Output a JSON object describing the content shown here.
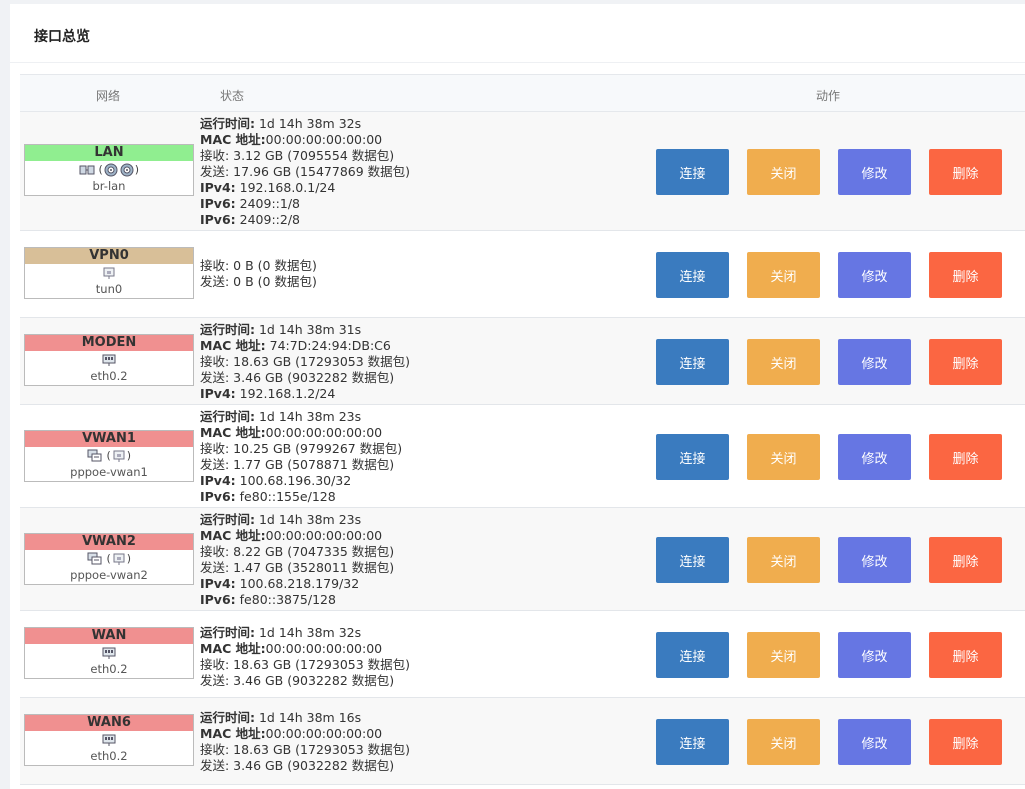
{
  "page": {
    "title": "接口总览"
  },
  "table": {
    "headers": {
      "network": "网络",
      "status": "状态",
      "actions": "动作"
    }
  },
  "buttons": {
    "connect": "连接",
    "close": "关闭",
    "edit": "修改",
    "delete": "删除"
  },
  "colors": {
    "connect": "#3a7bbf",
    "close": "#f0ad4e",
    "edit": "#6676e3",
    "delete": "#fb6642",
    "lan": "#90ee90",
    "vpn": "#d8bf98",
    "wan": "#f09090"
  },
  "rows": [
    {
      "name": "LAN",
      "device": "br-lan",
      "color": "green",
      "icons": [
        "bridge-icon",
        "wireless-icon",
        "wireless-icon"
      ],
      "status": [
        {
          "k": "运行时间:",
          "v": " 1d 14h 38m 32s"
        },
        {
          "k": "MAC 地址:",
          "v": "00:00:00:00:00:00"
        },
        {
          "k": "",
          "v": "接收: 3.12 GB (7095554 数据包)"
        },
        {
          "k": "",
          "v": "发送: 17.96 GB (15477869 数据包)"
        },
        {
          "k": "IPv4:",
          "v": " 192.168.0.1/24"
        },
        {
          "k": "IPv6:",
          "v": " 2409::1/8"
        },
        {
          "k": "IPv6:",
          "v": " 2409::2/8"
        }
      ]
    },
    {
      "name": "VPN0",
      "device": "tun0",
      "color": "tan",
      "icons": [
        "tunnel-icon"
      ],
      "status": [
        {
          "k": "",
          "v": "接收: 0 B (0 数据包)"
        },
        {
          "k": "",
          "v": "发送: 0 B (0 数据包)"
        }
      ]
    },
    {
      "name": "MODEN",
      "device": "eth0.2",
      "color": "red",
      "icons": [
        "ethernet-icon"
      ],
      "status": [
        {
          "k": "运行时间:",
          "v": " 1d 14h 38m 31s"
        },
        {
          "k": "MAC 地址:",
          "v": " 74:7D:24:94:DB:C6"
        },
        {
          "k": "",
          "v": "接收: 18.63 GB (17293053 数据包)"
        },
        {
          "k": "",
          "v": "发送: 3.46 GB (9032282 数据包)"
        },
        {
          "k": "IPv4:",
          "v": " 192.168.1.2/24"
        }
      ]
    },
    {
      "name": "VWAN1",
      "device": "pppoe-vwan1",
      "color": "red",
      "icons": [
        "pppoe-icon",
        "tunnel-icon"
      ],
      "status": [
        {
          "k": "运行时间:",
          "v": " 1d 14h 38m 23s"
        },
        {
          "k": "MAC 地址:",
          "v": "00:00:00:00:00:00"
        },
        {
          "k": "",
          "v": "接收: 10.25 GB (9799267 数据包)"
        },
        {
          "k": "",
          "v": "发送: 1.77 GB (5078871 数据包)"
        },
        {
          "k": "IPv4:",
          "v": " 100.68.196.30/32"
        },
        {
          "k": "IPv6:",
          "v": " fe80::155e/128"
        }
      ]
    },
    {
      "name": "VWAN2",
      "device": "pppoe-vwan2",
      "color": "red",
      "icons": [
        "pppoe-icon",
        "tunnel-icon"
      ],
      "status": [
        {
          "k": "运行时间:",
          "v": " 1d 14h 38m 23s"
        },
        {
          "k": "MAC 地址:",
          "v": "00:00:00:00:00:00"
        },
        {
          "k": "",
          "v": "接收: 8.22 GB (7047335 数据包)"
        },
        {
          "k": "",
          "v": "发送: 1.47 GB (3528011 数据包)"
        },
        {
          "k": "IPv4:",
          "v": " 100.68.218.179/32"
        },
        {
          "k": "IPv6:",
          "v": " fe80::3875/128"
        }
      ]
    },
    {
      "name": "WAN",
      "device": "eth0.2",
      "color": "red",
      "icons": [
        "ethernet-icon"
      ],
      "status": [
        {
          "k": "运行时间:",
          "v": " 1d 14h 38m 32s"
        },
        {
          "k": "MAC 地址:",
          "v": "00:00:00:00:00:00"
        },
        {
          "k": "",
          "v": "接收: 18.63 GB (17293053 数据包)"
        },
        {
          "k": "",
          "v": "发送: 3.46 GB (9032282 数据包)"
        }
      ]
    },
    {
      "name": "WAN6",
      "device": "eth0.2",
      "color": "red",
      "icons": [
        "ethernet-icon"
      ],
      "status": [
        {
          "k": "运行时间:",
          "v": " 1d 14h 38m 16s"
        },
        {
          "k": "MAC 地址:",
          "v": "00:00:00:00:00:00"
        },
        {
          "k": "",
          "v": "接收: 18.63 GB (17293053 数据包)"
        },
        {
          "k": "",
          "v": "发送: 3.46 GB (9032282 数据包)"
        }
      ]
    }
  ]
}
